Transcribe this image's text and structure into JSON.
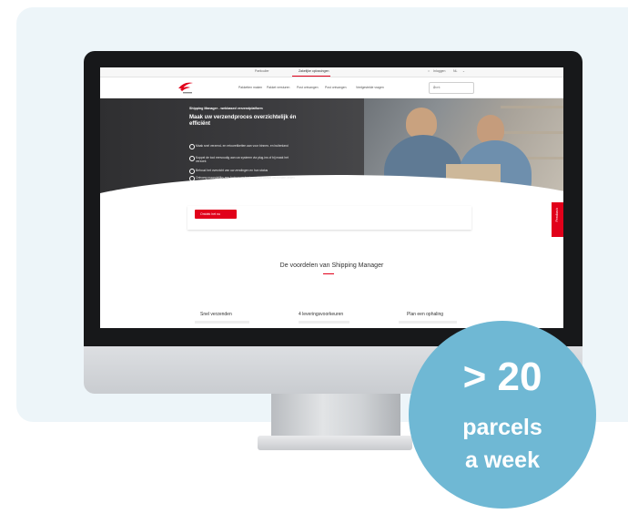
{
  "topbar": {
    "segments": [
      "Particulier",
      "Zakelijke oplossingen"
    ],
    "login": "Inloggen",
    "language": "NL"
  },
  "nav": {
    "items": [
      "Pakketten maken",
      "Pakket versturen",
      "Post ontvangen",
      "Post ontvangen",
      "Veelgestelde vragen"
    ],
    "search_placeholder": "Zoek"
  },
  "hero": {
    "kicker": "Shipping Manager - webbased verzendplatform",
    "headline": "Maak uw verzendproces overzichtelijk én efficiënt",
    "bullets": [
      "Maak snel verzend- en retouretiketten aan voor binnen- en buitenland",
      "Koppel de tool eenvoudig aan uw systeem via plug-ins of bij maak het verzoek",
      "Behoud het overzicht van uw zendingen en hun status",
      "Ontvang maandelijks een factuur op basis van het aantal verzonden zetjes"
    ],
    "cta": "Ontdek het nu"
  },
  "feedback_tab": "Feedback",
  "section": {
    "title": "De voordelen van Shipping Manager",
    "features": [
      "Snel verzenden",
      "4 leveringsvoorkeuren",
      "Plan een ophaling"
    ]
  },
  "badge": {
    "number": "> 20",
    "line1": "parcels",
    "line2": "a week"
  },
  "colors": {
    "brand_red": "#e1001a",
    "badge_blue": "#6fb8d4",
    "panel_bg": "#edf5f9"
  }
}
